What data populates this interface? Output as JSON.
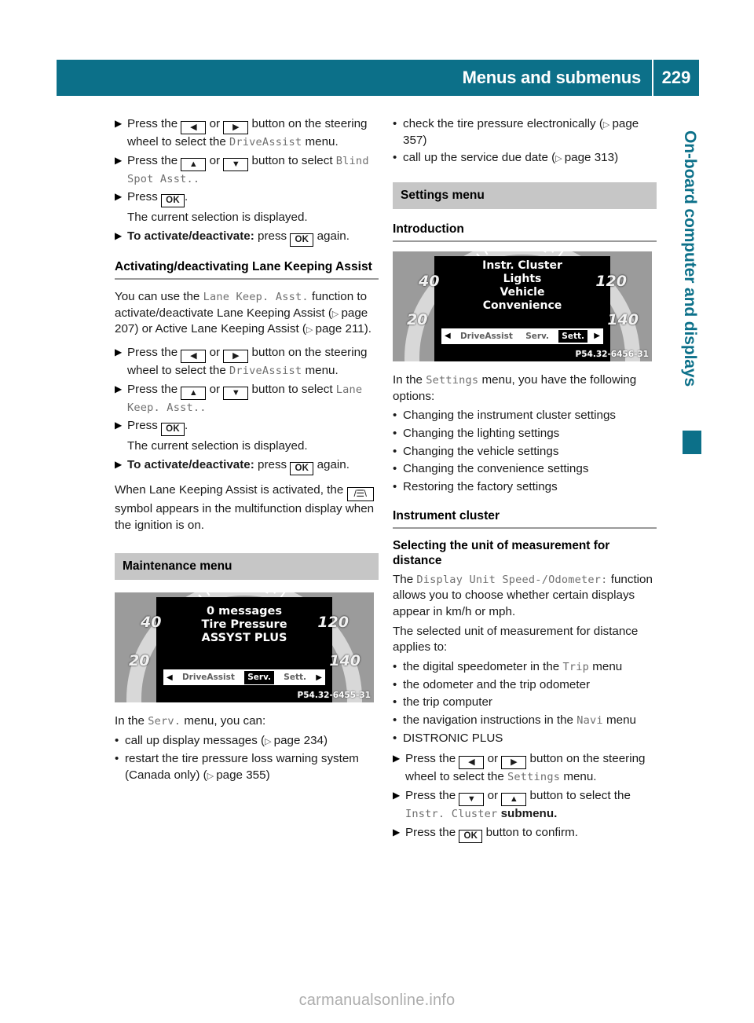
{
  "header": {
    "title": "Menus and submenus",
    "page_number": "229"
  },
  "side_tab": {
    "label": "On-board computer and displays"
  },
  "footer": {
    "watermark": "carmanualsonline.info"
  },
  "keys": {
    "left": "◀",
    "right": "▶",
    "up": "▲",
    "down": "▼",
    "ok": "OK",
    "lane_symbol": "/☰\\"
  },
  "left_column": {
    "blind_spot_steps": [
      {
        "parts": [
          {
            "t": "text",
            "v": "Press the "
          },
          {
            "t": "key",
            "v": "left"
          },
          {
            "t": "text",
            "v": " or "
          },
          {
            "t": "key",
            "v": "right"
          },
          {
            "t": "text",
            "v": " button on the steering wheel to select the "
          },
          {
            "t": "mono",
            "v": "DriveAssist"
          },
          {
            "t": "text",
            "v": " menu."
          }
        ]
      },
      {
        "parts": [
          {
            "t": "text",
            "v": "Press the "
          },
          {
            "t": "key",
            "v": "up"
          },
          {
            "t": "text",
            "v": " or "
          },
          {
            "t": "key",
            "v": "down"
          },
          {
            "t": "text",
            "v": " button to select "
          },
          {
            "t": "mono",
            "v": "Blind Spot Asst.."
          }
        ]
      },
      {
        "parts": [
          {
            "t": "text",
            "v": "Press "
          },
          {
            "t": "key",
            "v": "ok"
          },
          {
            "t": "text",
            "v": "."
          }
        ],
        "sub": "The current selection is displayed."
      },
      {
        "parts": [
          {
            "t": "bold",
            "v": "To activate/deactivate:"
          },
          {
            "t": "text",
            "v": " press "
          },
          {
            "t": "key",
            "v": "ok"
          },
          {
            "t": "text",
            "v": " again."
          }
        ]
      }
    ],
    "lane_heading": "Activating/deactivating Lane Keeping Assist",
    "lane_intro": [
      {
        "t": "text",
        "v": "You can use the "
      },
      {
        "t": "mono",
        "v": "Lane Keep. Asst."
      },
      {
        "t": "text",
        "v": " function to activate/deactivate Lane Keeping Assist ("
      },
      {
        "t": "ref",
        "v": "page 207"
      },
      {
        "t": "text",
        "v": ") or Active Lane Keeping Assist ("
      },
      {
        "t": "ref",
        "v": "page 211"
      },
      {
        "t": "text",
        "v": ")."
      }
    ],
    "lane_steps": [
      {
        "parts": [
          {
            "t": "text",
            "v": "Press the "
          },
          {
            "t": "key",
            "v": "left"
          },
          {
            "t": "text",
            "v": " or "
          },
          {
            "t": "key",
            "v": "right"
          },
          {
            "t": "text",
            "v": " button on the steering wheel to select the "
          },
          {
            "t": "mono",
            "v": "DriveAssist"
          },
          {
            "t": "text",
            "v": " menu."
          }
        ]
      },
      {
        "parts": [
          {
            "t": "text",
            "v": "Press the "
          },
          {
            "t": "key",
            "v": "up"
          },
          {
            "t": "text",
            "v": " or "
          },
          {
            "t": "key",
            "v": "down"
          },
          {
            "t": "text",
            "v": " button to select "
          },
          {
            "t": "mono",
            "v": "Lane Keep. Asst.."
          }
        ]
      },
      {
        "parts": [
          {
            "t": "text",
            "v": "Press "
          },
          {
            "t": "key",
            "v": "ok"
          },
          {
            "t": "text",
            "v": "."
          }
        ],
        "sub": "The current selection is displayed."
      },
      {
        "parts": [
          {
            "t": "bold",
            "v": "To activate/deactivate:"
          },
          {
            "t": "text",
            "v": " press "
          },
          {
            "t": "key",
            "v": "ok"
          },
          {
            "t": "text",
            "v": " again."
          }
        ]
      }
    ],
    "lane_note": [
      {
        "t": "text",
        "v": "When Lane Keeping Assist is activated, the "
      },
      {
        "t": "key",
        "v": "lane"
      },
      {
        "t": "text",
        "v": " symbol appears in the multifunction display when the ignition is on."
      }
    ],
    "maintenance_heading": "Maintenance menu",
    "maintenance_cluster": {
      "lines": [
        "0 messages",
        "Tire Pressure",
        "ASSYST PLUS"
      ],
      "speeds": {
        "left_top": "40",
        "left_bottom": "20",
        "right_top": "120",
        "right_bottom": "140"
      },
      "menu_items": [
        "DriveAssist",
        "Serv.",
        "Sett."
      ],
      "selected_menu": "Serv.",
      "image_code": "P54.32-6455-31"
    },
    "serv_intro": [
      {
        "t": "text",
        "v": "In the "
      },
      {
        "t": "mono",
        "v": "Serv."
      },
      {
        "t": "text",
        "v": " menu, you can:"
      }
    ],
    "serv_bullets": [
      [
        {
          "t": "text",
          "v": "call up display messages ("
        },
        {
          "t": "ref",
          "v": "page 234"
        },
        {
          "t": "text",
          "v": ")"
        }
      ],
      [
        {
          "t": "text",
          "v": "restart the tire pressure loss warning system (Canada only) ("
        },
        {
          "t": "ref",
          "v": "page 355"
        },
        {
          "t": "text",
          "v": ")"
        }
      ]
    ]
  },
  "right_column": {
    "top_bullets": [
      [
        {
          "t": "text",
          "v": "check the tire pressure electronically ("
        },
        {
          "t": "ref",
          "v": "page 357"
        },
        {
          "t": "text",
          "v": ")"
        }
      ],
      [
        {
          "t": "text",
          "v": "call up the service due date ("
        },
        {
          "t": "ref",
          "v": "page 313"
        },
        {
          "t": "text",
          "v": ")"
        }
      ]
    ],
    "settings_heading": "Settings menu",
    "introduction_heading": "Introduction",
    "settings_cluster": {
      "lines": [
        "Instr. Cluster",
        "Lights",
        "Vehicle",
        "Convenience"
      ],
      "speeds": {
        "left_top": "40",
        "left_bottom": "20",
        "right_top": "120",
        "right_bottom": "140"
      },
      "menu_items": [
        "DriveAssist",
        "Serv.",
        "Sett."
      ],
      "selected_menu": "Sett.",
      "image_code": "P54.32-6456-31"
    },
    "settings_intro": [
      {
        "t": "text",
        "v": "In the "
      },
      {
        "t": "mono",
        "v": "Settings"
      },
      {
        "t": "text",
        "v": " menu, you have the following options:"
      }
    ],
    "settings_bullets": [
      [
        {
          "t": "text",
          "v": "Changing the instrument cluster settings"
        }
      ],
      [
        {
          "t": "text",
          "v": "Changing the lighting settings"
        }
      ],
      [
        {
          "t": "text",
          "v": "Changing the vehicle settings"
        }
      ],
      [
        {
          "t": "text",
          "v": "Changing the convenience settings"
        }
      ],
      [
        {
          "t": "text",
          "v": "Restoring the factory settings"
        }
      ]
    ],
    "instrument_cluster_heading": "Instrument cluster",
    "unit_heading": "Selecting the unit of measurement for distance",
    "unit_para1": [
      {
        "t": "text",
        "v": "The "
      },
      {
        "t": "mono",
        "v": "Display Unit Speed-/Odometer:"
      },
      {
        "t": "text",
        "v": " function allows you to choose whether certain displays appear in km/h or mph."
      }
    ],
    "unit_para2": [
      {
        "t": "text",
        "v": "The selected unit of measurement for distance applies to:"
      }
    ],
    "unit_bullets": [
      [
        {
          "t": "text",
          "v": "the digital speedometer in the "
        },
        {
          "t": "mono",
          "v": "Trip"
        },
        {
          "t": "text",
          "v": " menu"
        }
      ],
      [
        {
          "t": "text",
          "v": "the odometer and the trip odometer"
        }
      ],
      [
        {
          "t": "text",
          "v": "the trip computer"
        }
      ],
      [
        {
          "t": "text",
          "v": "the navigation instructions in the "
        },
        {
          "t": "mono",
          "v": "Navi"
        },
        {
          "t": "text",
          "v": " menu"
        }
      ],
      [
        {
          "t": "text",
          "v": "DISTRONIC PLUS"
        }
      ]
    ],
    "unit_steps": [
      {
        "parts": [
          {
            "t": "text",
            "v": "Press the "
          },
          {
            "t": "key",
            "v": "left"
          },
          {
            "t": "text",
            "v": " or "
          },
          {
            "t": "key",
            "v": "right"
          },
          {
            "t": "text",
            "v": " button on the steering wheel to select the "
          },
          {
            "t": "mono",
            "v": "Settings"
          },
          {
            "t": "text",
            "v": " menu."
          }
        ]
      },
      {
        "parts": [
          {
            "t": "text",
            "v": "Press the "
          },
          {
            "t": "key",
            "v": "down"
          },
          {
            "t": "text",
            "v": " or "
          },
          {
            "t": "key",
            "v": "up"
          },
          {
            "t": "text",
            "v": " button to select the "
          },
          {
            "t": "mono",
            "v": "Instr. Cluster"
          },
          {
            "t": "bold",
            "v": " submenu."
          }
        ]
      },
      {
        "parts": [
          {
            "t": "text",
            "v": "Press the "
          },
          {
            "t": "key",
            "v": "ok"
          },
          {
            "t": "text",
            "v": " button to confirm."
          }
        ]
      }
    ]
  },
  "colors": {
    "brand_teal": "#0c7089",
    "section_gray": "#c6c6c6",
    "mono_gray": "#6f6f6f",
    "rule_gray": "#9a9a9a",
    "watermark_gray": "#adadad"
  }
}
